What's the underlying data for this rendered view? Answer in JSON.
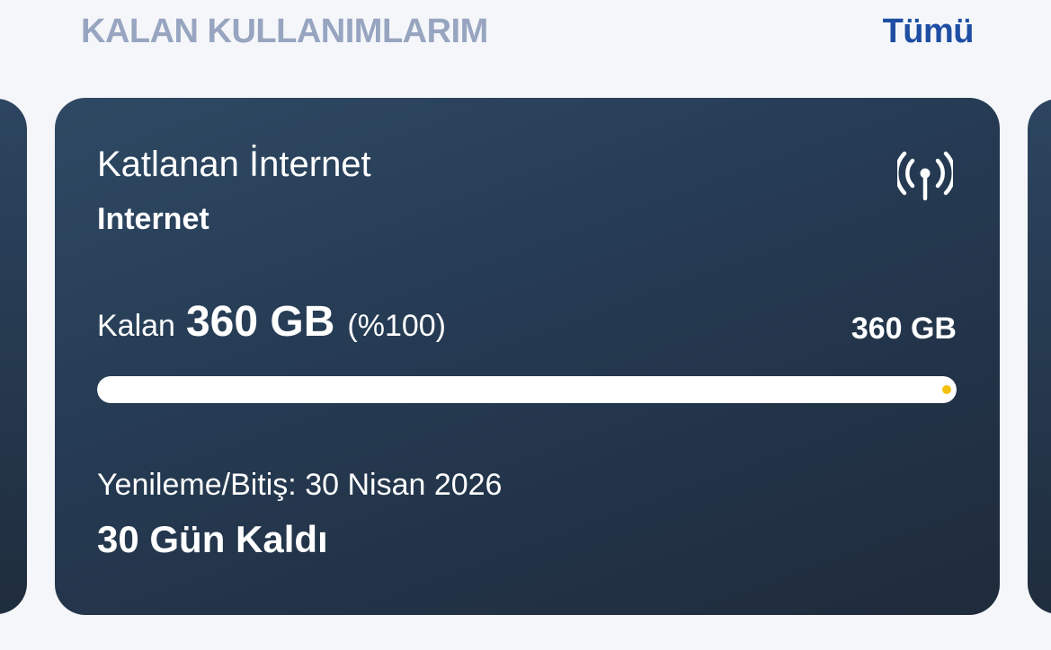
{
  "header": {
    "section_title": "KALAN KULLANIMLARIM",
    "see_all_label": "Tümü"
  },
  "card": {
    "title": "Katlanan İnternet",
    "subtitle": "Internet",
    "icon": "antenna-signal-icon",
    "remaining_label": "Kalan",
    "remaining_amount": "360 GB",
    "remaining_percent": "(%100)",
    "total": "360 GB",
    "progress_fraction": 1.0,
    "progress_indicator_color": "#f4c20d",
    "renewal": "Yenileme/Bitiş: 30 Nisan 2026",
    "days_left": "30 Gün Kaldı"
  },
  "colors": {
    "background": "#f5f6f9",
    "section_title": "#97a5c0",
    "see_all": "#1d4ea3",
    "card_gradient_start": "#2f4964",
    "card_gradient_end": "#1f2b3b",
    "text": "#ffffff"
  }
}
